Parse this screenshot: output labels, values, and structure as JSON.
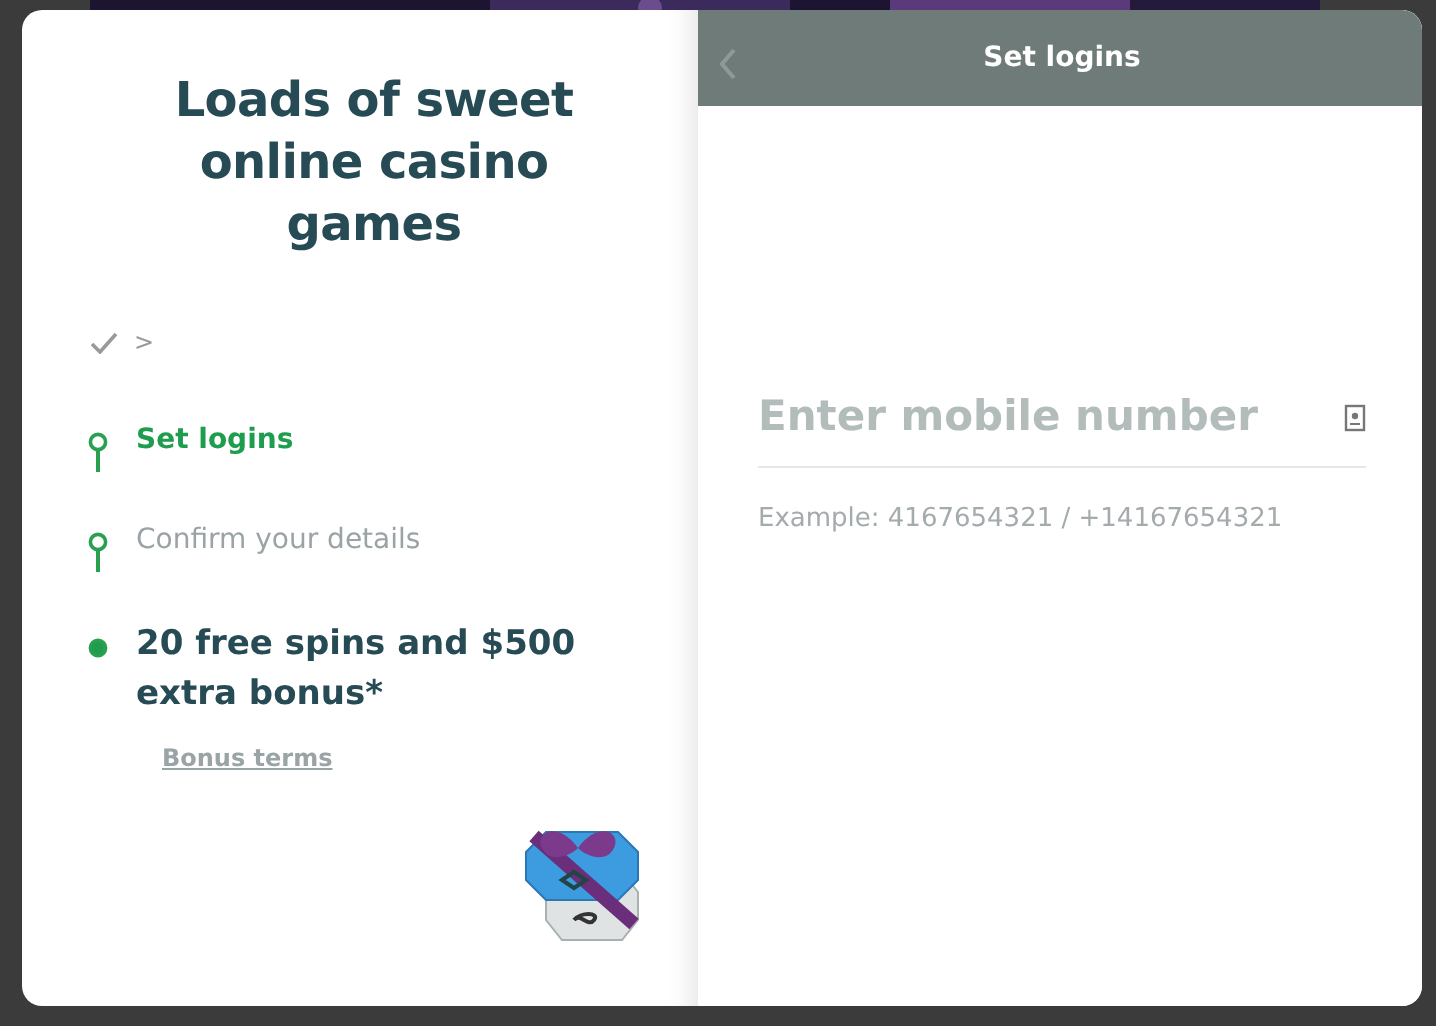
{
  "left": {
    "headline": "Loads of sweet online casino games",
    "done_step": {
      "arrow": ">"
    },
    "steps": [
      {
        "label": "Set logins",
        "kind": "current"
      },
      {
        "label": "Confirm your details",
        "kind": "pending"
      },
      {
        "label": "20 free spins and $500 extra bonus*",
        "kind": "reward"
      }
    ],
    "terms_link": "Bonus terms"
  },
  "right": {
    "header_title": "Set logins",
    "phone_field": {
      "placeholder": "Enter mobile number"
    },
    "hint": "Example: 4167654321 / +14167654321"
  }
}
